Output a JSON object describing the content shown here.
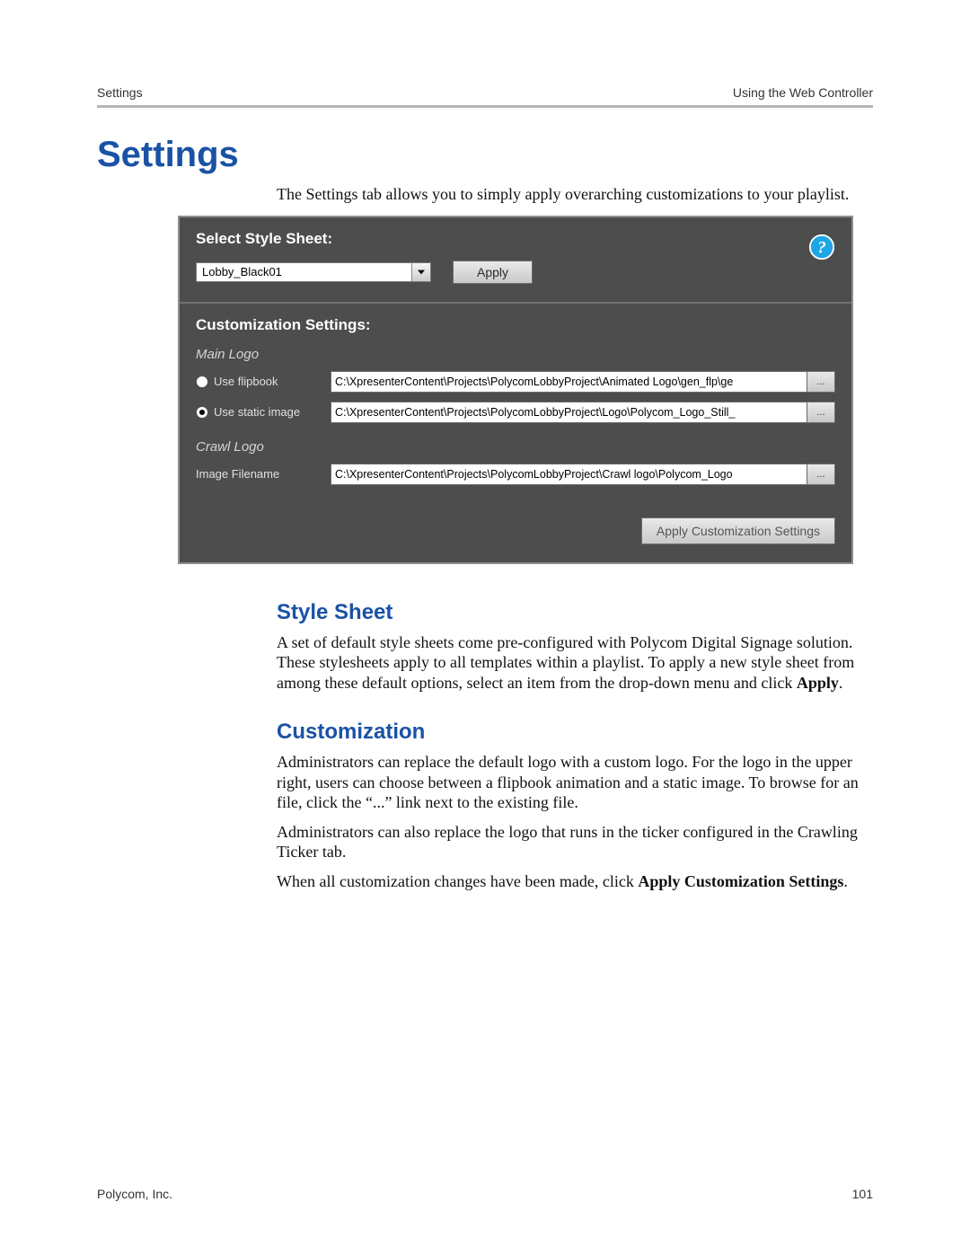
{
  "header": {
    "left": "Settings",
    "right": "Using the Web Controller"
  },
  "title": "Settings",
  "intro": "The Settings tab allows you to simply apply overarching customizations to your playlist.",
  "panel": {
    "stylesheet_heading": "Select Style Sheet:",
    "stylesheet_value": "Lobby_Black01",
    "apply_label": "Apply",
    "cust_heading": "Customization Settings:",
    "main_logo_heading": "Main Logo",
    "flipbook_label": "Use flipbook",
    "flipbook_path": "C:\\XpresenterContent\\Projects\\PolycomLobbyProject\\Animated Logo\\gen_flp\\ge",
    "static_label": "Use static image",
    "static_path": "C:\\XpresenterContent\\Projects\\PolycomLobbyProject\\Logo\\Polycom_Logo_Still_",
    "crawl_heading": "Crawl Logo",
    "image_filename_label": "Image Filename",
    "crawl_path": "C:\\XpresenterContent\\Projects\\PolycomLobbyProject\\Crawl logo\\Polycom_Logo",
    "browse_label": "...",
    "apply_cust_label": "Apply Customization Settings"
  },
  "stylesheet_section": {
    "heading": "Style Sheet",
    "para_a": "A set of default style sheets come pre-configured with Polycom Digital Signage solution. These stylesheets apply to all templates within a playlist. To apply a new style sheet from among these default options, select an item from the drop-down menu and click ",
    "para_bold": "Apply",
    "para_end": "."
  },
  "customization_section": {
    "heading": "Customization",
    "p1": "Administrators can replace the default logo with a custom logo. For the logo in the upper right, users can choose between a flipbook animation and a static image. To browse for an file, click the “...” link next to the existing file.",
    "p2": "Administrators can also replace the logo that runs in the ticker configured in the Crawling Ticker tab.",
    "p3_a": "When all customization changes have been made, click ",
    "p3_bold": "Apply Customization Settings",
    "p3_end": "."
  },
  "footer": {
    "left": "Polycom, Inc.",
    "right": "101"
  }
}
